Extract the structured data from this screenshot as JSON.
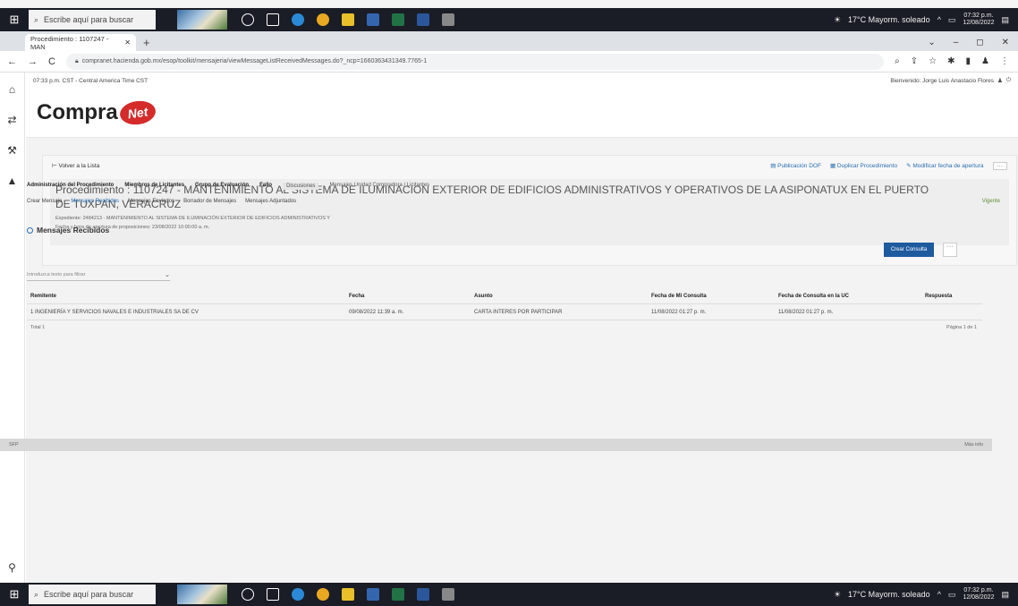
{
  "taskbar": {
    "search_placeholder": "Escribe aquí para buscar",
    "weather": "17°C Mayorm. soleado",
    "clock_time": "07:32 p.m.",
    "clock_date": "12/08/2022"
  },
  "browser": {
    "tab_title": "Procedimiento : 1107247 - MAN",
    "url": "compranet.hacienda.gob.mx/esop/toolkit/mensajeria/viewMessageListReceivedMessages.do?_ncp=1660363431349.7765-1"
  },
  "header": {
    "time": "07:33 p.m. CST - Central America Time CST",
    "user": "Bienvenido: Jorge Luis Anastacio Flores",
    "logo_text": "Compra",
    "logo_net": "Net"
  },
  "procedure": {
    "back_link": "Volver a la Lista",
    "action_dof": "Publicación DOF",
    "action_duplicate": "Duplicar Procedimiento",
    "action_verify": "Modificar fecha de apertura",
    "more": "···",
    "title": "Procedimiento : 1107247 - MANTENIMIENTO AL SISTEMA DE ILUMINACION EXTERIOR DE EDIFICIOS ADMINISTRATIVOS Y OPERATIVOS DE LA ASIPONATUX EN EL PUERTO DE TUXPAN, VERACRUZ",
    "expediente": "Expediente: 2484213 - MANTENIMIENTO AL SISTEMA DE ILUMINACIÓN EXTERIOR DE EDIFICIOS ADMINISTRATIVOS Y",
    "fecha": "Fecha y hora de apertura de proposiciones: 23/08/2022 10:00:00 a. m.",
    "status": "Vigente"
  },
  "tabs1": [
    "Administración del Procedimiento",
    "Miembros de Licitantes",
    "Grupo de Evaluación",
    "Fallo",
    "Discusiones",
    "Mensajes Unidad Compradora / Licitantes"
  ],
  "tabs2": [
    "Crear Mensaje",
    "Mensajes Recibidos",
    "Mensajes Enviados",
    "Borrador de Mensajes",
    "Mensajes Adjuntados"
  ],
  "messages": {
    "title": "Mensajes Recibidos",
    "create_button": "Crear Consulta",
    "more_button": "···",
    "filter_placeholder": "Introduzca texto para filtrar",
    "columns": [
      "Remitente",
      "Fecha",
      "Asunto",
      "Fecha de Mi Consulta",
      "Fecha de Consulta en la UC",
      "Respuesta"
    ],
    "rows": [
      [
        "1   INGENIERÍA Y SERVICIOS NAVALES E INDUSTRIALES SA DE CV",
        "09/08/2022 11:39 a. m.",
        "CARTA INTERES POR PARTICIPAR",
        "11/08/2022 01:27 p. m.",
        "11/08/2022 01:27 p. m.",
        ""
      ]
    ],
    "total": "Total 1",
    "pagination": "Página 1 de 1"
  },
  "footer": {
    "left": "SFP",
    "right": "Más info"
  }
}
